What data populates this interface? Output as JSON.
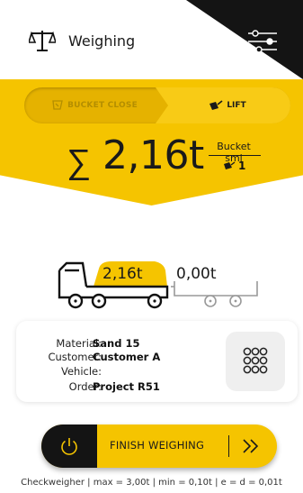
{
  "header": {
    "title": "Weighing",
    "icons": {
      "app": "scale-icon",
      "settings": "sliders-icon"
    }
  },
  "mode_toggle": {
    "left_label": "BUCKET CLOSE",
    "right_label": "LIFT",
    "active": "LIFT"
  },
  "total": {
    "symbol": "∑",
    "value": "2,16t",
    "bucket_label": "Bucket sml",
    "bucket_count": "1"
  },
  "vehicles": {
    "truck_value": "2,16t",
    "trailer_value": "0,00t"
  },
  "info": {
    "rows": [
      {
        "key": "Material:",
        "value": "Sand 15"
      },
      {
        "key": "Customer:",
        "value": "Customer A"
      },
      {
        "key": "Vehicle:",
        "value": ""
      },
      {
        "key": "Order:",
        "value": "Project R51"
      }
    ],
    "keypad_icon": "keypad-icon"
  },
  "finish": {
    "label": "FINISH WEIGHING",
    "icons": {
      "power": "power-icon",
      "next": "double-chevron-right-icon"
    }
  },
  "footer": "Checkweigher | max = 3,00t | min = 0,10t | e = d = 0,01t",
  "colors": {
    "accent": "#f5c400",
    "dark": "#141414"
  }
}
